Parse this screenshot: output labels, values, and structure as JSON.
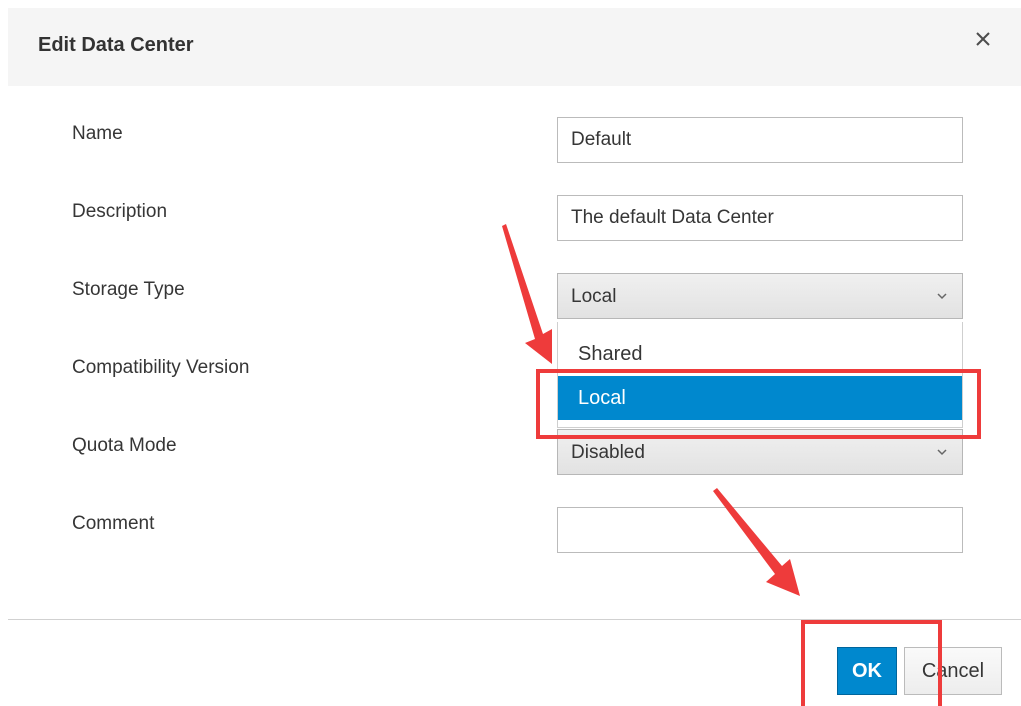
{
  "dialog": {
    "title": "Edit Data Center"
  },
  "form": {
    "name": {
      "label": "Name",
      "value": "Default"
    },
    "description": {
      "label": "Description",
      "value": "The default Data Center"
    },
    "storage_type": {
      "label": "Storage Type",
      "value": "Local",
      "options": [
        "Shared",
        "Local"
      ],
      "highlighted_option": "Local"
    },
    "compatibility_version": {
      "label": "Compatibility Version"
    },
    "quota_mode": {
      "label": "Quota Mode",
      "value": "Disabled"
    },
    "comment": {
      "label": "Comment",
      "value": ""
    }
  },
  "footer": {
    "ok_label": "OK",
    "cancel_label": "Cancel"
  },
  "icons": {
    "close": "close-icon",
    "chevron": "chevron-down-icon"
  },
  "colors": {
    "primary": "#0088ce",
    "annotation": "#ee3b3b",
    "header_bg": "#f5f5f5"
  }
}
